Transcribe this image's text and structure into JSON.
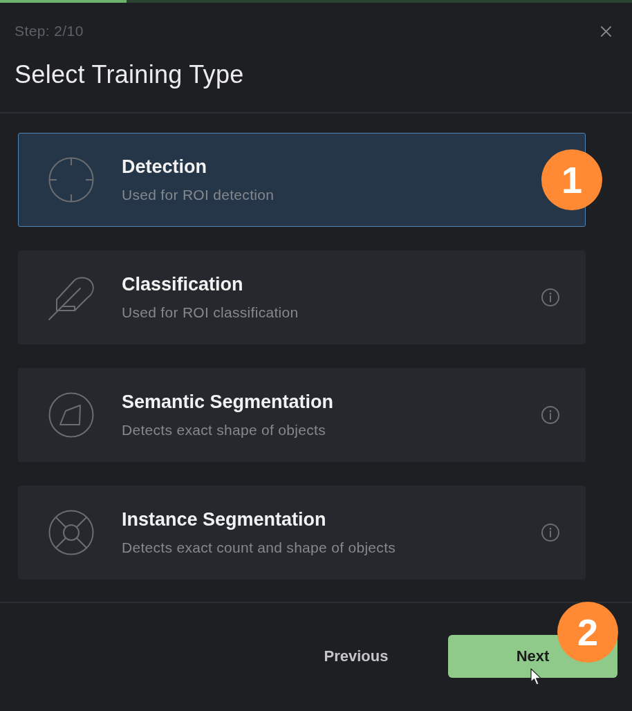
{
  "progress": {
    "level": 0.2
  },
  "step": "Step: 2/10",
  "title": "Select Training Type",
  "options": [
    {
      "kind": "crosshair",
      "title": "Detection",
      "description": "Used for ROI detection",
      "selected": true,
      "info": false,
      "marker": "1"
    },
    {
      "kind": "feather",
      "title": "Classification",
      "description": "Used for ROI classification",
      "selected": false,
      "info": true
    },
    {
      "kind": "polygon",
      "title": "Semantic Segmentation",
      "description": "Detects exact shape of objects",
      "selected": false,
      "info": true
    },
    {
      "kind": "lifebuoy",
      "title": "Instance Segmentation",
      "description": "Detects exact count and shape of objects",
      "selected": false,
      "info": true
    }
  ],
  "footer": {
    "previous": "Previous",
    "next": {
      "label": "Next",
      "marker": "2"
    }
  }
}
